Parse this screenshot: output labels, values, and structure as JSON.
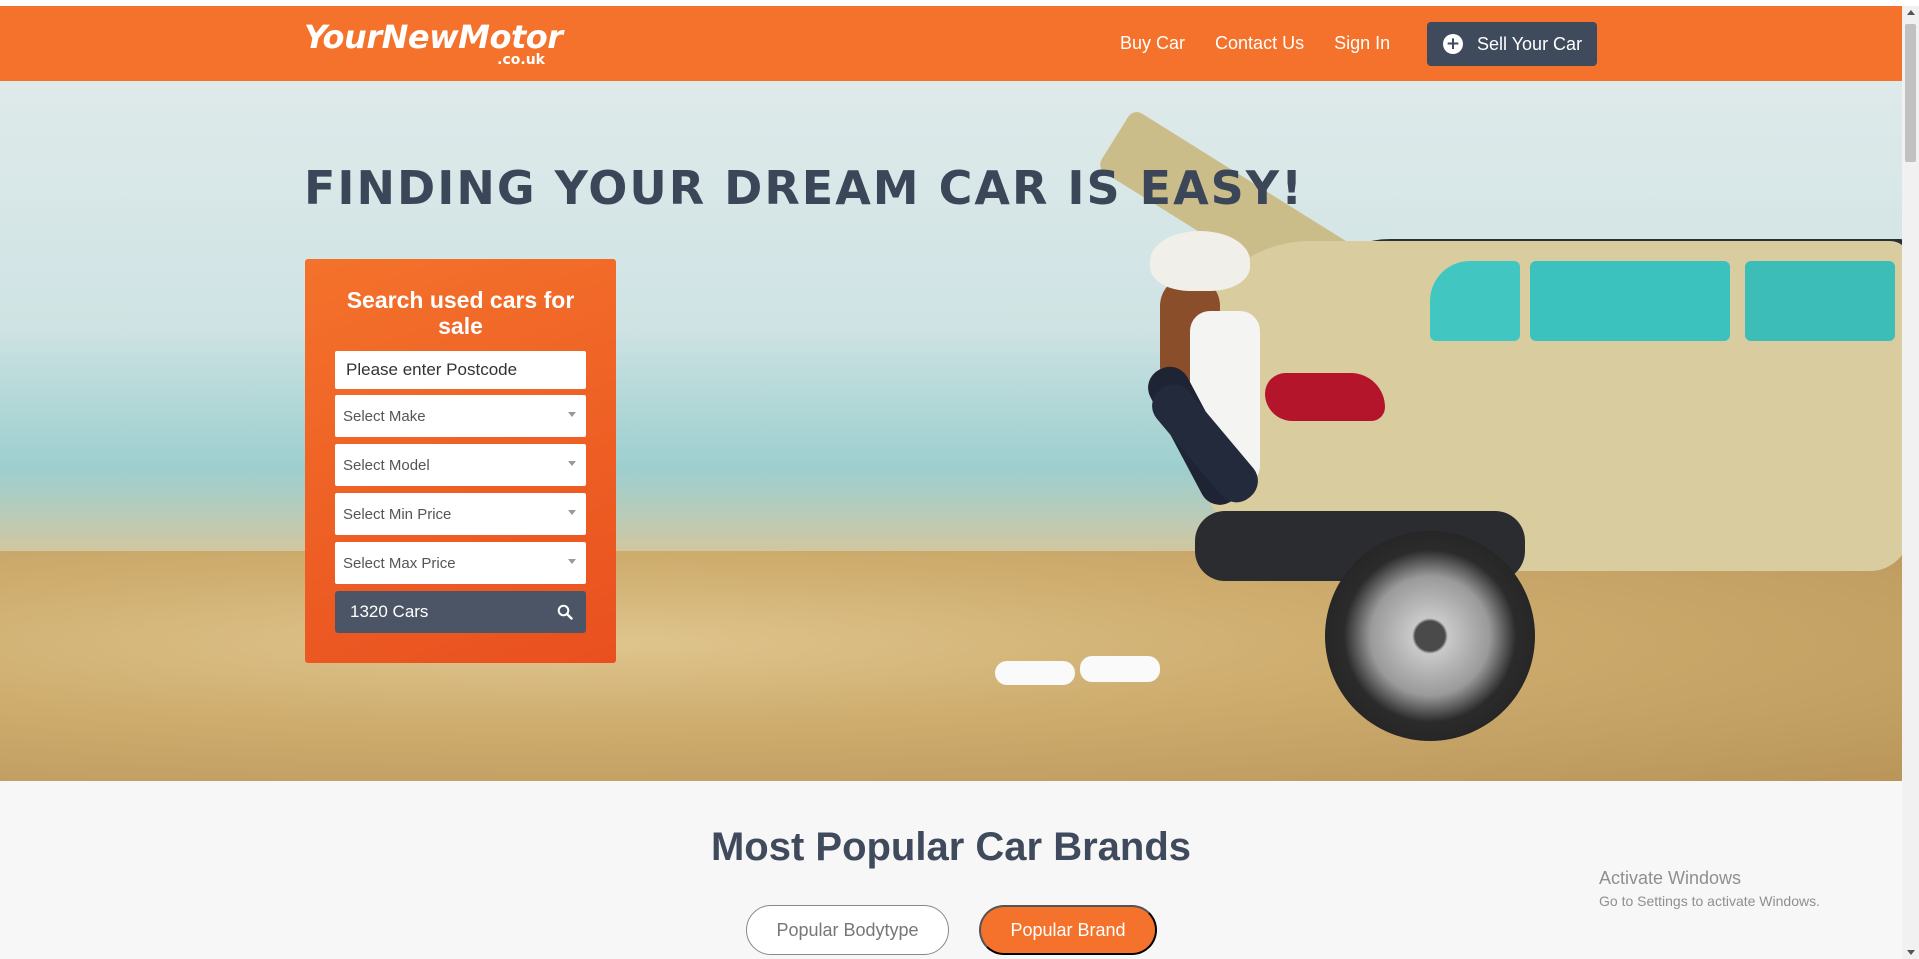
{
  "header": {
    "logo_main": "YourNewMotor",
    "logo_sub": ".co.uk",
    "nav": [
      {
        "label": "Buy Car"
      },
      {
        "label": "Contact Us"
      },
      {
        "label": "Sign In"
      }
    ],
    "sell_button": {
      "icon": "plus-icon",
      "label": "Sell Your Car"
    }
  },
  "hero": {
    "title": "FINDING YOUR DREAM CAR IS EASY!"
  },
  "search": {
    "heading": "Search used cars for sale",
    "postcode_placeholder": "Please enter Postcode",
    "make": "Select Make",
    "model": "Select Model",
    "min_price": "Select Min Price",
    "max_price": "Select Max Price",
    "submit_label": "1320 Cars",
    "submit_icon": "search-icon"
  },
  "brands_section": {
    "title": "Most Popular Car Brands",
    "tabs": [
      {
        "label": "Popular Bodytype",
        "active": false
      },
      {
        "label": "Popular Brand",
        "active": true
      }
    ]
  },
  "watermark": {
    "line1": "Activate Windows",
    "line2": "Go to Settings to activate Windows."
  },
  "colors": {
    "brand_orange": "#f4722b",
    "dark_slate": "#3f4a5c"
  }
}
